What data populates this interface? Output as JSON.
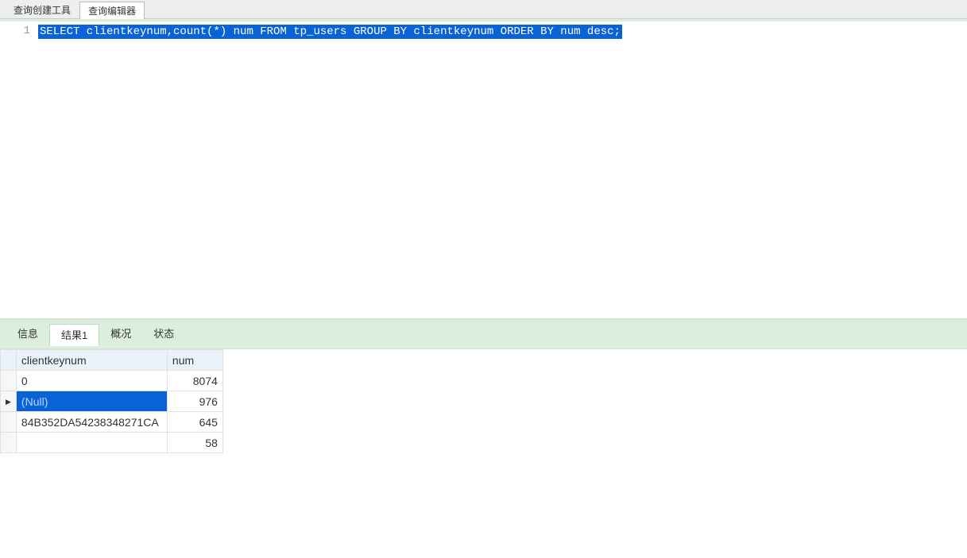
{
  "top_tabs": {
    "items": [
      {
        "label": "查询创建工具",
        "active": false
      },
      {
        "label": "查询编辑器",
        "active": true
      }
    ]
  },
  "editor": {
    "line_numbers": [
      "1"
    ],
    "sql": "SELECT clientkeynum,count(*) num FROM tp_users GROUP BY clientkeynum ORDER BY num desc;"
  },
  "bottom_tabs": {
    "items": [
      {
        "label": "信息",
        "active": false
      },
      {
        "label": "结果1",
        "active": true
      },
      {
        "label": "概况",
        "active": false
      },
      {
        "label": "状态",
        "active": false
      }
    ]
  },
  "results": {
    "columns": [
      "clientkeynum",
      "num"
    ],
    "rows": [
      {
        "clientkeynum": "0",
        "num": "8074",
        "selected": false
      },
      {
        "clientkeynum": "(Null)",
        "num": "976",
        "selected": true
      },
      {
        "clientkeynum": "84B352DA54238348271CA",
        "num": "645",
        "selected": false
      },
      {
        "clientkeynum": "",
        "num": "58",
        "selected": false
      }
    ]
  }
}
